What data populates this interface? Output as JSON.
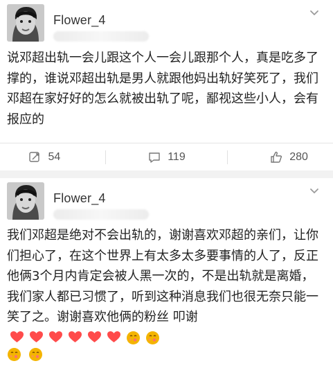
{
  "posts": [
    {
      "username": "Flower_4",
      "text": "说邓超出轨一会儿跟这个人一会儿跟那个人，真是吃多了撑的，谁说邓超出轨是男人就跟他妈出轨好笑死了，我们邓超在家好好的怎么就被出轨了呢，鄙视这些小人，会有报应的",
      "actions": {
        "repost": "54",
        "comment": "119",
        "like": "280"
      },
      "icons": {
        "avatar": "avatar-image",
        "menu": "chevron-down-icon",
        "repost": "repost-icon",
        "comment": "comment-icon",
        "like": "thumbs-up-icon"
      }
    },
    {
      "username": "Flower_4",
      "text": "我们邓超是绝对不会出轨的，谢谢喜欢邓超的亲们，让你们担心了，在这个世界上有太多太多要事情的人了，反正他俩3个月内肯定会被人黑一次的，不是出轨就是离婚，我们家人都已习惯了，听到这种消息我们也很无奈只能一笑了之。谢谢喜欢他俩的粉丝 叩谢",
      "emoji": {
        "heart_count": 6,
        "kiss_count_line_1": 2,
        "kiss_count_line_2": 2
      },
      "icons": {
        "avatar": "avatar-image",
        "menu": "chevron-down-icon",
        "heart": "heart-icon",
        "kiss": "kiss-face-icon"
      }
    }
  ],
  "colors": {
    "background": "#f2f2f2",
    "card": "#ffffff",
    "text": "#222222",
    "muted": "#555555",
    "heart": "#ff4b4b",
    "emoji": "#f4b400"
  }
}
